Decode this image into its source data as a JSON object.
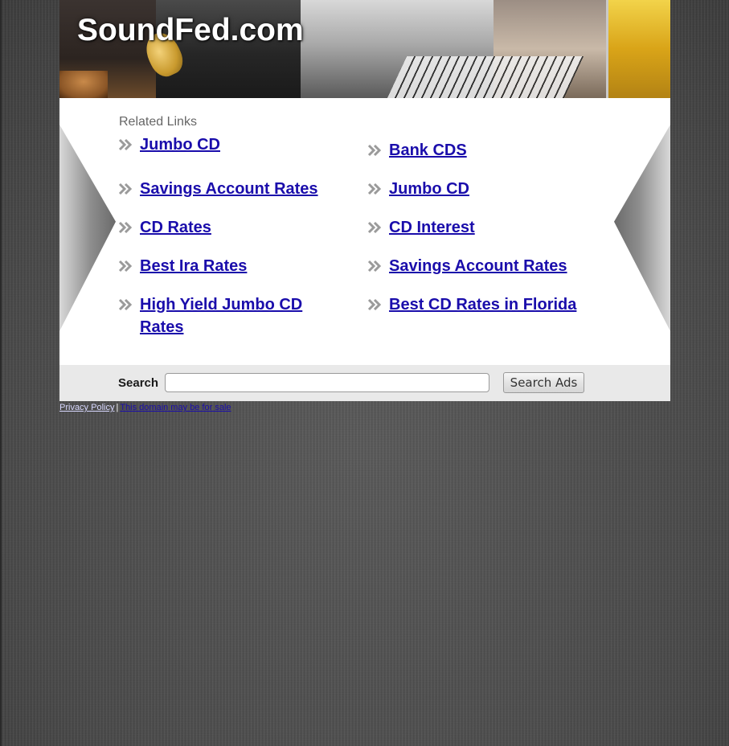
{
  "header": {
    "site_title": "SoundFed.com"
  },
  "related": {
    "heading": "Related Links",
    "left_links": [
      {
        "label": "Jumbo CD"
      },
      {
        "label": "Savings Account Rates"
      },
      {
        "label": "CD Rates"
      },
      {
        "label": "Best Ira Rates"
      },
      {
        "label": "High Yield Jumbo CD Rates"
      }
    ],
    "right_links": [
      {
        "label": "Bank CDS"
      },
      {
        "label": "Jumbo CD"
      },
      {
        "label": "CD Interest"
      },
      {
        "label": "Savings Account Rates"
      },
      {
        "label": "Best CD Rates in Florida"
      }
    ],
    "link_color": "#1a0dab",
    "arrow_icon": "double-chevron-right-icon"
  },
  "search": {
    "label": "Search",
    "value": "",
    "button_label": "Search Ads"
  },
  "footer": {
    "privacy_label": "Privacy Policy",
    "separator": "|",
    "sale_label": "This domain may be for sale"
  }
}
